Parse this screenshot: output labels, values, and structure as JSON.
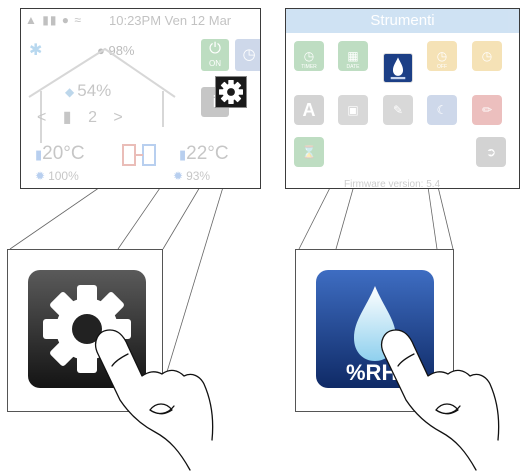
{
  "left_screen": {
    "status_time": "10:23PM Ven 12 Mar",
    "signal_percent": "98%",
    "humidity": "54%",
    "zone": "2",
    "temp_left": "20°C",
    "temp_right": "22°C",
    "fan_left": "100%",
    "fan_right": "93%",
    "on_label": "ON",
    "info_label": "i"
  },
  "right_screen": {
    "title": "Strumenti",
    "version_text": "Firmware version: 5.4",
    "tools": [
      {
        "cap": "TIMER",
        "color": "#3c9b48"
      },
      {
        "cap": "DATE",
        "color": "#3c9b48"
      },
      {
        "cap": "%RH",
        "color": "#1c3f86"
      },
      {
        "cap": "OFF",
        "color": "#e3a824"
      },
      {
        "cap": "",
        "color": "#e3a824"
      },
      {
        "cap": "A",
        "color": "#7d7d7d"
      },
      {
        "cap": "",
        "color": "#8a8a8a"
      },
      {
        "cap": "",
        "color": "#8a8a8a"
      },
      {
        "cap": "",
        "color": "#6e8cc2"
      },
      {
        "cap": "",
        "color": "#c8413c"
      },
      {
        "cap": "",
        "color": "#3c9b48"
      },
      {
        "cap": "",
        "color": "#7d7d7d"
      }
    ]
  },
  "zoom_right": {
    "rh_label": "%RH"
  },
  "colors": {
    "gear_dark": "#1a1a1a",
    "rh_blue": "#1c3f86"
  }
}
